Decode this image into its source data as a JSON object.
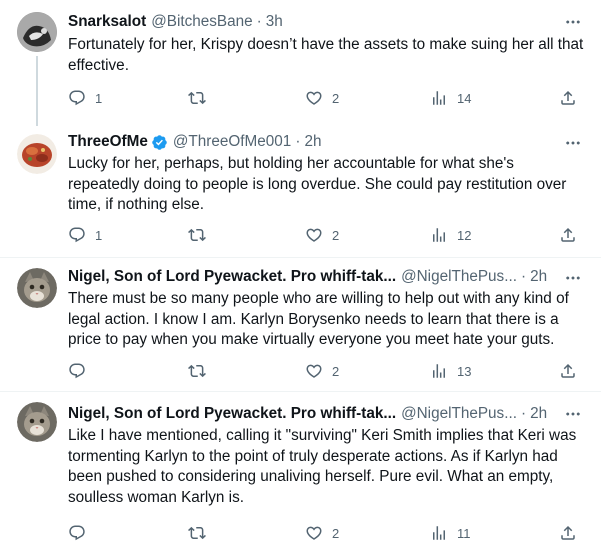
{
  "tweets": [
    {
      "name": "Snarksalot",
      "handle": "@BitchesBane",
      "time": "3h",
      "text": "Fortunately for her, Krispy doesn’t have the assets to make suing her all that effective.",
      "reply_count": "1",
      "retweet_count": "",
      "like_count": "2",
      "view_count": "14",
      "verified": false
    },
    {
      "name": "ThreeOfMe",
      "handle": "@ThreeOfMe001",
      "time": "2h",
      "text": "Lucky for her, perhaps, but holding her accountable for what she's repeatedly doing to people is long overdue. She could pay restitution over time, if nothing else.",
      "reply_count": "1",
      "retweet_count": "",
      "like_count": "2",
      "view_count": "12",
      "verified": true
    },
    {
      "name": "Nigel, Son of Lord Pyewacket. Pro whiff-tak...",
      "handle": "@NigelThePus...",
      "time": "2h",
      "text": "There must be so many people who are willing to help out with any kind of legal action.  I know I am.  Karlyn Borysenko needs to learn that there is a price to pay when you make virtually everyone you meet hate your guts.",
      "reply_count": "",
      "retweet_count": "",
      "like_count": "2",
      "view_count": "13",
      "verified": false
    },
    {
      "name": "Nigel, Son of Lord Pyewacket. Pro whiff-tak...",
      "handle": "@NigelThePus...",
      "time": "2h",
      "text": "Like I have mentioned, calling it \"surviving\" Keri Smith implies that Keri was tormenting Karlyn to the point of truly desperate actions.  As if Karlyn had been pushed to considering unaliving herself. Pure evil.  What an empty, soulless woman Karlyn is.",
      "reply_count": "",
      "retweet_count": "",
      "like_count": "2",
      "view_count": "11",
      "verified": false
    }
  ],
  "separator": "·",
  "colors": {
    "text": "#0f1419",
    "muted": "#536471",
    "verified": "#1d9bf0",
    "divider": "#eff3f4",
    "thread_line": "#cfd9de"
  },
  "icons": [
    "reply-icon",
    "retweet-icon",
    "like-icon",
    "views-icon",
    "share-icon",
    "more-icon",
    "verified-badge-icon"
  ]
}
